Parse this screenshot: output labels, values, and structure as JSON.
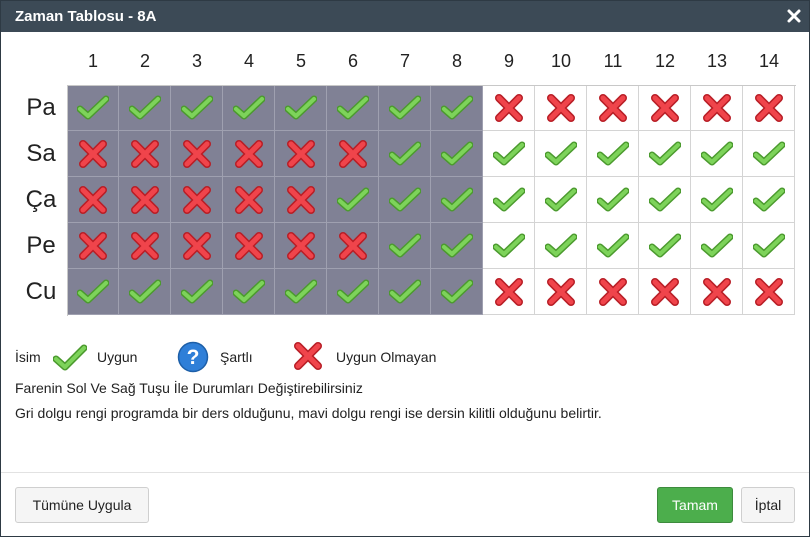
{
  "window": {
    "title": "Zaman Tablosu - 8A"
  },
  "grid": {
    "columns": [
      "1",
      "2",
      "3",
      "4",
      "5",
      "6",
      "7",
      "8",
      "9",
      "10",
      "11",
      "12",
      "13",
      "14"
    ],
    "rows": [
      {
        "day": "Pa",
        "cells": [
          "check",
          "check",
          "check",
          "check",
          "check",
          "check",
          "check",
          "check",
          "cross",
          "cross",
          "cross",
          "cross",
          "cross",
          "cross"
        ]
      },
      {
        "day": "Sa",
        "cells": [
          "cross",
          "cross",
          "cross",
          "cross",
          "cross",
          "cross",
          "check",
          "check",
          "check",
          "check",
          "check",
          "check",
          "check",
          "check"
        ]
      },
      {
        "day": "Ça",
        "cells": [
          "cross",
          "cross",
          "cross",
          "cross",
          "cross",
          "check",
          "check",
          "check",
          "check",
          "check",
          "check",
          "check",
          "check",
          "check"
        ]
      },
      {
        "day": "Pe",
        "cells": [
          "cross",
          "cross",
          "cross",
          "cross",
          "cross",
          "cross",
          "check",
          "check",
          "check",
          "check",
          "check",
          "check",
          "check",
          "check"
        ]
      },
      {
        "day": "Cu",
        "cells": [
          "check",
          "check",
          "check",
          "check",
          "check",
          "check",
          "check",
          "check",
          "cross",
          "cross",
          "cross",
          "cross",
          "cross",
          "cross"
        ]
      }
    ],
    "fill": [
      [
        "gray",
        "gray",
        "gray",
        "gray",
        "gray",
        "gray",
        "gray",
        "gray",
        "white",
        "white",
        "white",
        "white",
        "white",
        "white"
      ],
      [
        "gray",
        "gray",
        "gray",
        "gray",
        "gray",
        "gray",
        "gray",
        "gray",
        "white",
        "white",
        "white",
        "white",
        "white",
        "white"
      ],
      [
        "gray",
        "gray",
        "gray",
        "gray",
        "gray",
        "gray",
        "gray",
        "gray",
        "white",
        "white",
        "white",
        "white",
        "white",
        "white"
      ],
      [
        "gray",
        "gray",
        "gray",
        "gray",
        "gray",
        "gray",
        "gray",
        "gray",
        "white",
        "white",
        "white",
        "white",
        "white",
        "white"
      ],
      [
        "gray",
        "gray",
        "gray",
        "gray",
        "gray",
        "gray",
        "gray",
        "gray",
        "white",
        "white",
        "white",
        "white",
        "white",
        "white"
      ]
    ]
  },
  "legend": {
    "name_label": "İsim",
    "available_label": "Uygun",
    "conditional_label": "Şartlı",
    "unavailable_label": "Uygun Olmayan"
  },
  "info": {
    "line1": "Farenin Sol Ve Sağ Tuşu İle Durumları Değiştirebilirsiniz",
    "line2": "Gri dolgu rengi programda bir ders olduğunu, mavi dolgu rengi ise dersin kilitli olduğunu belirtir."
  },
  "buttons": {
    "apply_all": "Tümüne Uygula",
    "ok": "Tamam",
    "cancel": "İptal"
  },
  "colors": {
    "titlebar": "#3c4a56",
    "gray_fill": "#808195",
    "check": "#6cc04a",
    "cross": "#e8343c",
    "question": "#2f7fd8",
    "primary_button": "#4cae4c"
  }
}
